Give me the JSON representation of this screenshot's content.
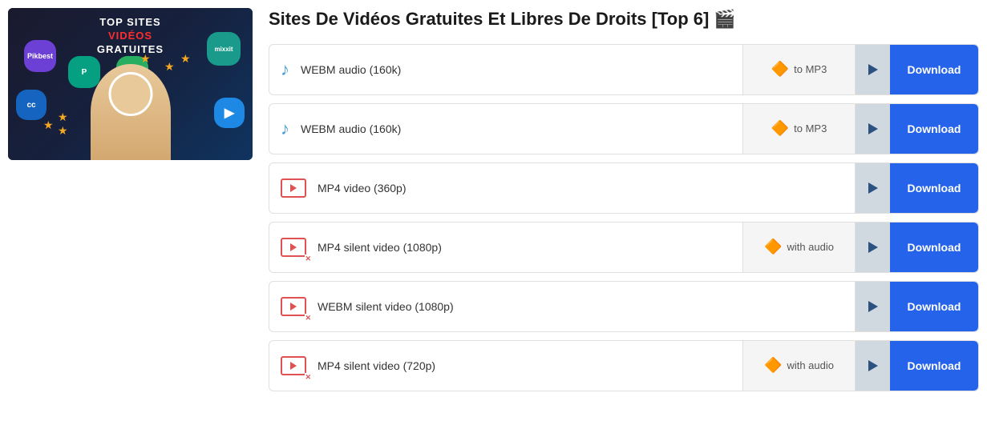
{
  "thumbnail": {
    "title_line1": "TOP SITES",
    "title_line2_red": "VIDÉOS",
    "title_line3": "GRATUITES"
  },
  "page_title": "Sites De Vidéos Gratuites Et Libres De Droits [Top 6] 🎬",
  "rows": [
    {
      "id": "row1",
      "icon_type": "music",
      "label": "WEBM audio (160k)",
      "badge": "to MP3",
      "has_badge": true,
      "download_label": "Download"
    },
    {
      "id": "row2",
      "icon_type": "music",
      "label": "WEBM audio (160k)",
      "badge": "to MP3",
      "has_badge": true,
      "download_label": "Download"
    },
    {
      "id": "row3",
      "icon_type": "video",
      "label": "MP4 video (360p)",
      "badge": "",
      "has_badge": false,
      "download_label": "Download"
    },
    {
      "id": "row4",
      "icon_type": "video-silent",
      "label": "MP4 silent video (1080p)",
      "badge": "with audio",
      "has_badge": true,
      "download_label": "Download"
    },
    {
      "id": "row5",
      "icon_type": "video-silent",
      "label": "WEBM silent video (1080p)",
      "badge": "",
      "has_badge": false,
      "download_label": "Download"
    },
    {
      "id": "row6",
      "icon_type": "video-silent",
      "label": "MP4 silent video (720p)",
      "badge": "with audio",
      "has_badge": true,
      "download_label": "Download"
    }
  ],
  "badge_labels": {
    "to_mp3": "to MP3",
    "with_audio": "with audio"
  }
}
